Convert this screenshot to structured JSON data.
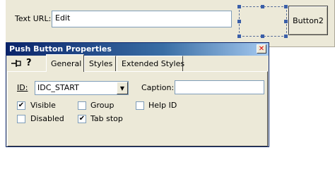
{
  "dialog_canvas": {
    "text_url_label": "Text URL:",
    "url_edit_value": "Edit",
    "button2_label": "Button2"
  },
  "properties": {
    "title": "Push Button Properties",
    "pin_icon": "pin-icon",
    "help_icon": "question-icon",
    "tabs": [
      {
        "label": "General",
        "active": true
      },
      {
        "label": "Styles",
        "active": false
      },
      {
        "label": "Extended Styles",
        "active": false
      }
    ],
    "id_label": "ID:",
    "id_value": "IDC_START",
    "caption_label": "Caption:",
    "caption_value": "",
    "checkboxes": {
      "visible": {
        "label": "Visible",
        "checked": true
      },
      "group": {
        "label": "Group",
        "checked": false
      },
      "help_id": {
        "label": "Help ID",
        "checked": false
      },
      "disabled": {
        "label": "Disabled",
        "checked": false
      },
      "tab_stop": {
        "label": "Tab stop",
        "checked": true
      }
    }
  },
  "colors": {
    "titlebar_start": "#0a246a",
    "titlebar_end": "#a6caf0",
    "face": "#ece9d8"
  }
}
